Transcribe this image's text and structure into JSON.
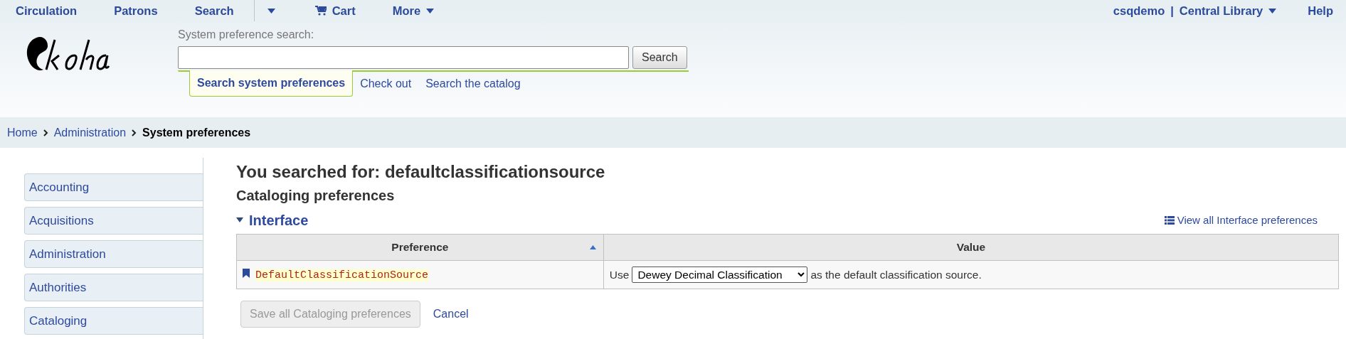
{
  "top_nav": {
    "left": [
      {
        "label": "Circulation",
        "kind": "link"
      },
      {
        "label": "Patrons",
        "kind": "link"
      },
      {
        "label": "Search",
        "kind": "link"
      },
      {
        "kind": "caret"
      },
      {
        "label": "Cart",
        "kind": "cart"
      },
      {
        "label": "More",
        "kind": "dropdown"
      }
    ],
    "user": "csqdemo",
    "separator": "|",
    "library": "Central Library",
    "help": "Help"
  },
  "search": {
    "label": "System preference search:",
    "button": "Search",
    "tabs": [
      {
        "label": "Search system preferences",
        "selected": true
      },
      {
        "label": "Check out",
        "selected": false
      },
      {
        "label": "Search the catalog",
        "selected": false
      }
    ]
  },
  "breadcrumb": [
    {
      "label": "Home",
      "current": false
    },
    {
      "label": "Administration",
      "current": false
    },
    {
      "label": "System preferences",
      "current": true
    }
  ],
  "sidebar": {
    "items": [
      {
        "label": "Accounting"
      },
      {
        "label": "Acquisitions"
      },
      {
        "label": "Administration"
      },
      {
        "label": "Authorities"
      },
      {
        "label": "Cataloging"
      }
    ]
  },
  "heading": "You searched for: defaultclassificationsource",
  "subheading": "Cataloging preferences",
  "section": {
    "title": "Interface",
    "expanded": true,
    "view_all": "View all Interface preferences"
  },
  "table": {
    "columns": [
      {
        "label": "Preference",
        "sorted": true
      },
      {
        "label": "Value",
        "sorted": false
      }
    ],
    "rows": [
      {
        "preference": "DefaultClassificationSource",
        "before": "Use",
        "select": "Dewey Decimal Classification",
        "after": "as the default classification source."
      }
    ]
  },
  "actions": {
    "save": {
      "label": "Save all Cataloging preferences",
      "disabled": true
    },
    "cancel": "Cancel"
  }
}
